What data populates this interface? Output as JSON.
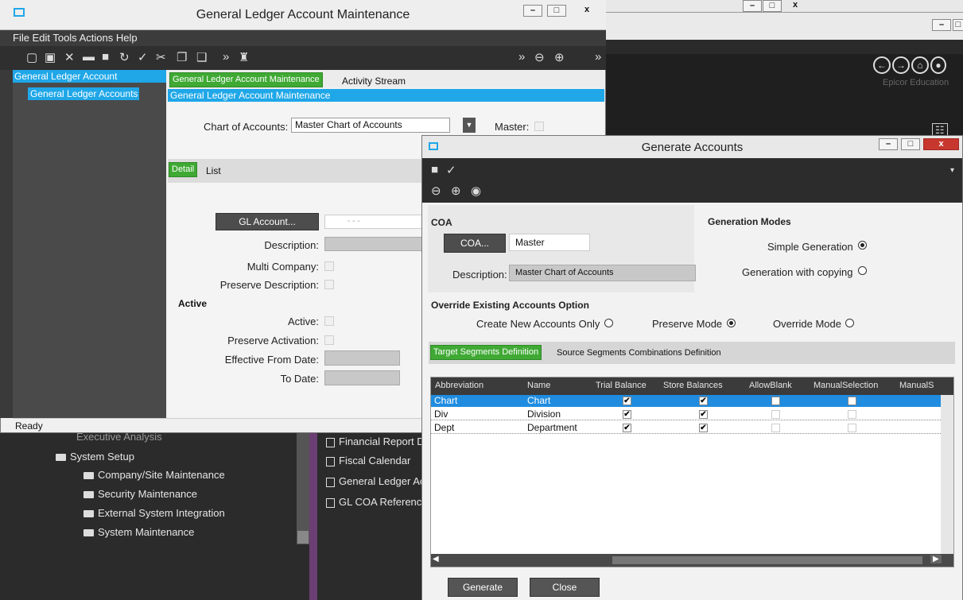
{
  "background": {
    "brand": "Epicor Education",
    "menu": {
      "partial_top": "Executive Analysis",
      "system_setup": "System Setup",
      "items": [
        "Company/Site Maintenance",
        "Security Maintenance",
        "External System Integration",
        "System Maintenance"
      ],
      "right_items": [
        "Financial Report D",
        "Fiscal Calendar",
        "General Ledger Ac",
        "GL COA Reference"
      ]
    }
  },
  "gl": {
    "title": "General Ledger Account Maintenance",
    "menubar": "File  Edit  Tools  Actions  Help",
    "tree_header": "General Ledger Account",
    "tree_item": "General Ledger Accounts",
    "tab_main": "General Ledger Account Maintenance",
    "tab_activity": "Activity Stream",
    "blue_header": "General Ledger Account Maintenance",
    "chart_label": "Chart of Accounts:",
    "chart_value": "Master Chart of Accounts",
    "master_label": "Master:",
    "tab_detail": "Detail",
    "tab_list": "List",
    "glaccount_btn": "GL Account...",
    "glaccount_value": "- - -",
    "description_label": "Description:",
    "multicompany_label": "Multi Company:",
    "preserve_desc_label": "Preserve Description:",
    "active_section": "Active",
    "active_label": "Active:",
    "preserve_activation_label": "Preserve Activation:",
    "eff_from_label": "Effective From Date:",
    "to_date_label": "To Date:",
    "status": "Ready"
  },
  "ga": {
    "title": "Generate Accounts",
    "coa_section": "COA",
    "coa_btn": "COA...",
    "coa_value": "Master",
    "desc_label": "Description:",
    "desc_value": "Master Chart of Accounts",
    "gen_modes": "Generation Modes",
    "simple_gen": "Simple Generation",
    "gen_copying": "Generation with copying",
    "override_section": "Override Existing Accounts Option",
    "create_new": "Create New Accounts Only",
    "preserve_mode": "Preserve Mode",
    "override_mode": "Override Mode",
    "tab_target": "Target Segments Definition",
    "tab_source": "Source Segments Combinations Definition",
    "columns": [
      "Abbreviation",
      "Name",
      "Trial Balance",
      "Store Balances",
      "AllowBlank",
      "ManualSelection",
      "ManualS"
    ],
    "rows": [
      {
        "abbr": "Chart",
        "name": "Chart",
        "trial": true,
        "store": true,
        "allow": false,
        "manual": false
      },
      {
        "abbr": "Div",
        "name": "Division",
        "trial": true,
        "store": true,
        "allow": false,
        "manual": false
      },
      {
        "abbr": "Dept",
        "name": "Department",
        "trial": true,
        "store": true,
        "allow": false,
        "manual": false
      }
    ],
    "generate_btn": "Generate",
    "close_btn": "Close"
  },
  "colors": {
    "accent_blue": "#1fa7e8",
    "tab_green": "#3fa934",
    "toolbar_dark": "#2f2f2f"
  }
}
